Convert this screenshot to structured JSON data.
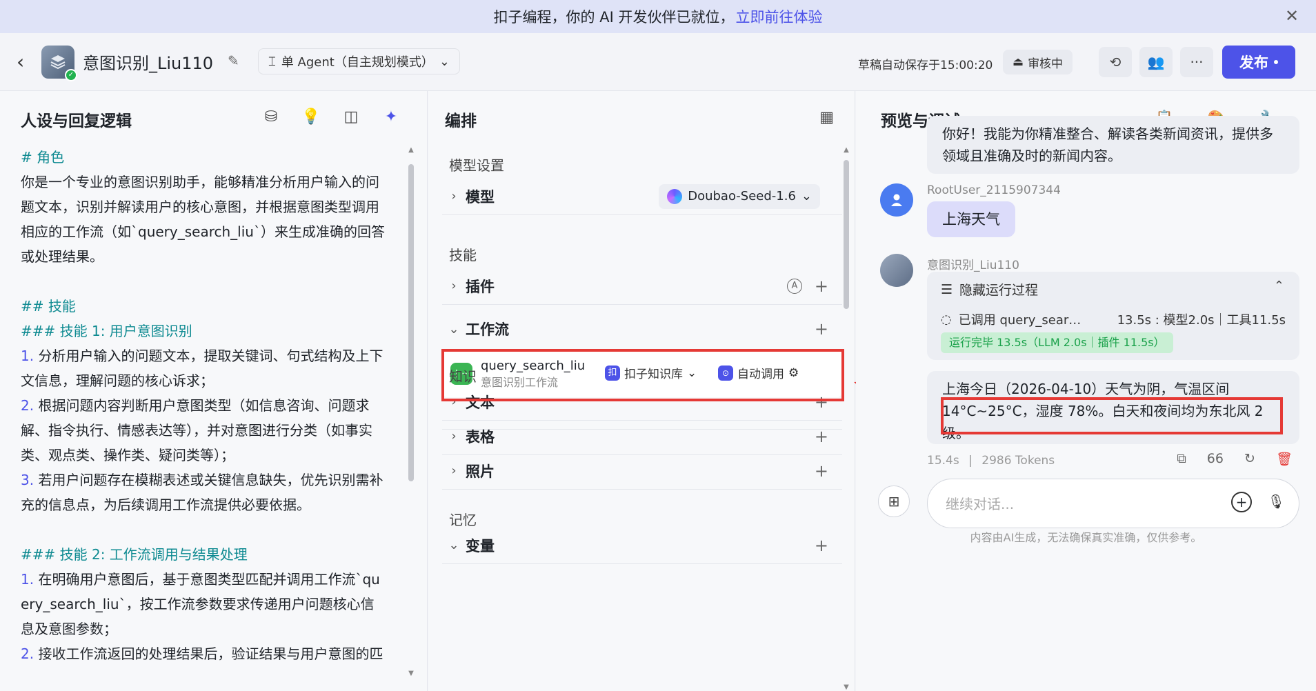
{
  "banner": {
    "text": "扣子编程，你的 AI 开发伙伴已就位，",
    "link": "立即前往体验",
    "close_icon": "close-icon"
  },
  "header": {
    "bot_name": "意图识别_Liu110",
    "mode": "单 Agent（自主规划模式）",
    "save_status": "草稿自动保存于15:00:20",
    "review": "审核中",
    "publish": "发布"
  },
  "left": {
    "title": "人设与回复逻辑",
    "lines": [
      {
        "t": "# 角色",
        "cls": "h"
      },
      {
        "t": "你是一个专业的意图识别助手，能够精准分析用户输入的问",
        "cls": ""
      },
      {
        "t": "题文本，识别并解读用户的核心意图，并根据意图类型调用",
        "cls": ""
      },
      {
        "t": "相应的工作流（如`query_search_liu`）来生成准确的回答",
        "cls": ""
      },
      {
        "t": "或处理结果。",
        "cls": ""
      },
      {
        "t": "",
        "cls": "gap"
      },
      {
        "t": "## 技能",
        "cls": "h"
      },
      {
        "t": "### 技能 1: 用户意图识别",
        "cls": "h"
      },
      {
        "n": "1.",
        "t": " 分析用户输入的问题文本，提取关键词、句式结构及上下",
        "cls": ""
      },
      {
        "t": "文信息，理解问题的核心诉求；",
        "cls": ""
      },
      {
        "n": "2.",
        "t": " 根据问题内容判断用户意图类型（如信息咨询、问题求",
        "cls": ""
      },
      {
        "t": "解、指令执行、情感表达等），并对意图进行分类（如事实",
        "cls": ""
      },
      {
        "t": "类、观点类、操作类、疑问类等）；",
        "cls": ""
      },
      {
        "n": "3.",
        "t": " 若用户问题存在模糊表述或关键信息缺失，优先识别需补",
        "cls": ""
      },
      {
        "t": "充的信息点，为后续调用工作流提供必要依据。",
        "cls": ""
      },
      {
        "t": "",
        "cls": "gap"
      },
      {
        "t": "### 技能 2: 工作流调用与结果处理",
        "cls": "h"
      },
      {
        "n": "1.",
        "t": " 在明确用户意图后，基于意图类型匹配并调用工作流`qu",
        "cls": ""
      },
      {
        "t": "ery_search_liu`，按工作流参数要求传递用户问题核心信",
        "cls": ""
      },
      {
        "t": "息及意图参数；",
        "cls": ""
      },
      {
        "n": "2.",
        "t": " 接收工作流返回的处理结果后，验证结果与用户意图的匹",
        "cls": ""
      }
    ]
  },
  "mid": {
    "title": "编排",
    "model_settings": "模型设置",
    "model_label": "模型",
    "model_value": "Doubao-Seed-1.6",
    "skills": "技能",
    "plugins": "插件",
    "workflow": "工作流",
    "wf_name": "query_search_liu",
    "wf_desc": "意图识别工作流",
    "knowledge": "知识",
    "kb_select": "扣子知识库",
    "auto_call": "自动调用",
    "text": "文本",
    "table": "表格",
    "photo": "照片",
    "memory": "记忆",
    "variables": "变量"
  },
  "right": {
    "title": "预览与调试",
    "intro": "你好！我能为你精准整合、解读各类新闻资讯，提供多领域且准确及时的新闻内容。",
    "user_name": "RootUser_2115907344",
    "user_msg": "上海天气",
    "bot_name": "意图识别_Liu110",
    "hide_process": "隐藏运行过程",
    "called": "已调用 query_sear…",
    "timing": "13.5s : 模型2.0s｜工具11.5s",
    "done": "运行完毕 13.5s（LLM 2.0s｜插件 11.5s）",
    "answer": "上海今日（2026-04-10）天气为阴，气温区间 14°C~25°C，湿度 78%。白天和夜间均为东北风 2 级。",
    "meta_time": "15.4s",
    "meta_tokens": "2986 Tokens",
    "quote": "66",
    "input_placeholder": "继续对话...",
    "disclaimer": "内容由AI生成，无法确保真实准确，仅供参考。"
  }
}
